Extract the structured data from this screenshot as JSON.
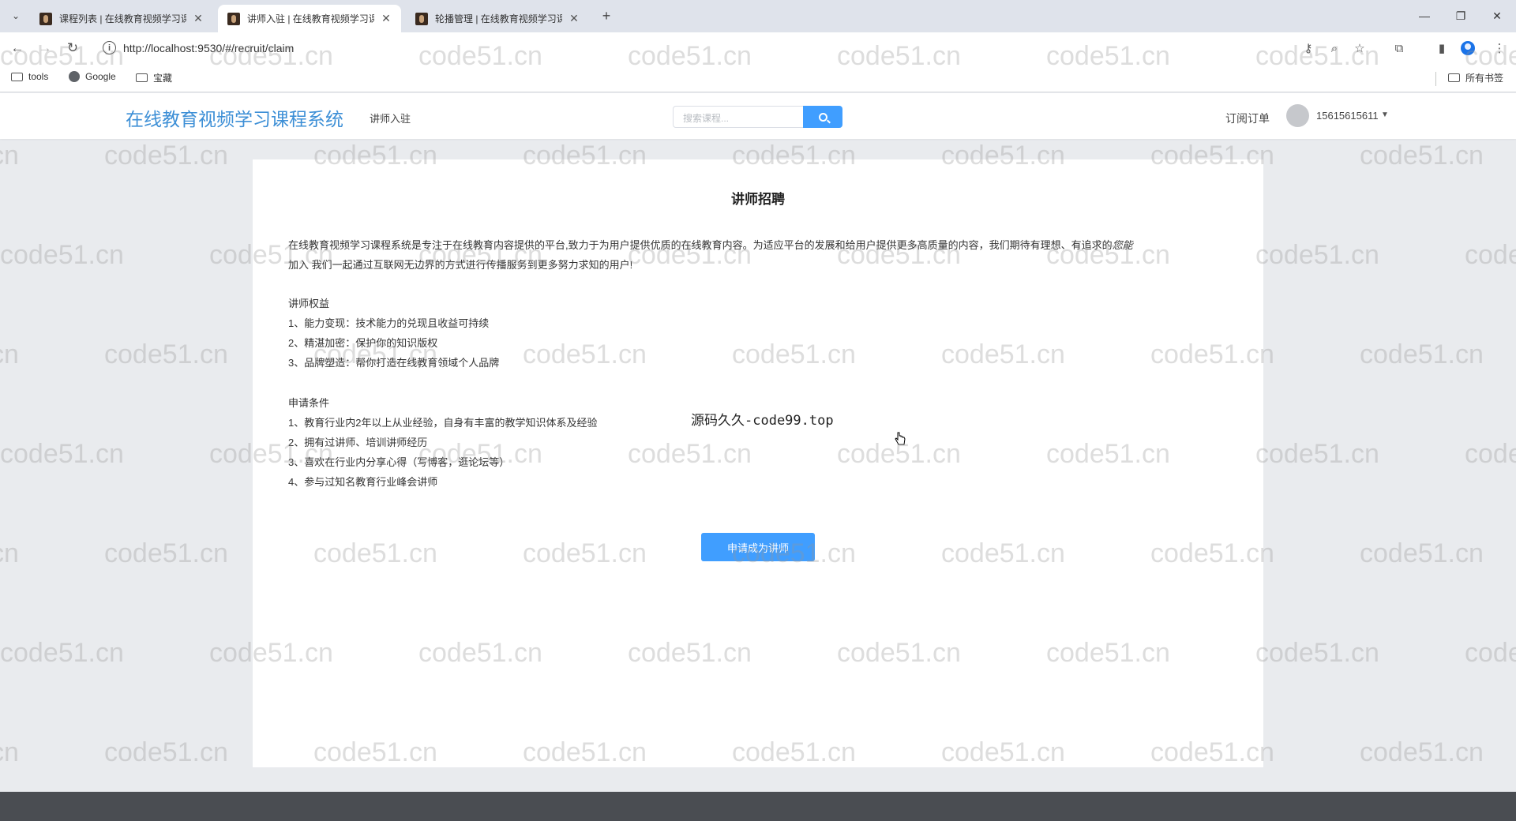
{
  "browser": {
    "tabs": [
      {
        "title": "课程列表 | 在线教育视频学习课",
        "active": false
      },
      {
        "title": "讲师入驻 | 在线教育视频学习课",
        "active": true
      },
      {
        "title": "轮播管理 | 在线教育视频学习课",
        "active": false
      }
    ],
    "url": "http://localhost:9530/#/recruit/claim",
    "bookmarks": [
      {
        "label": "tools",
        "icon": "folder-icon"
      },
      {
        "label": "Google",
        "icon": "globe-icon"
      },
      {
        "label": "宝藏",
        "icon": "folder-icon"
      }
    ],
    "all_bookmarks_label": "所有书签"
  },
  "header": {
    "logo": "在线教育视频学习课程系统",
    "nav_link": "讲师入驻",
    "search_placeholder": "搜索课程...",
    "orders_link": "订阅订单",
    "user_phone": "15615615611"
  },
  "main": {
    "title": "讲师招聘",
    "intro_line1": "在线教育视频学习课程系统是专注于在线教育内容提供的平台,致力于为用户提供优质的在线教育内容。为适应平台的发展和给用户提供更多高质量的内容，我们期待有理想、有追求的",
    "intro_em": "您能",
    "intro_line2": "加入 我们一起通过互联网无边界的方式进行传播服务到更多努力求知的用户!",
    "benefits_heading": "讲师权益",
    "benefits": [
      "1、能力变现：技术能力的兑现且收益可持续",
      "2、精湛加密：保护你的知识版权",
      "3、品牌塑造：帮你打造在线教育领域个人品牌"
    ],
    "conditions_heading": "申请条件",
    "conditions": [
      "1、教育行业内2年以上从业经验，自身有丰富的教学知识体系及经验",
      "2、拥有过讲师、培训讲师经历",
      "3、喜欢在行业内分享心得（写博客，逛论坛等）",
      "4、参与过知名教育行业峰会讲师"
    ],
    "apply_button": "申请成为讲师"
  },
  "overlay_text": "源码久久-code99.top",
  "watermark_text": "code51.cn",
  "colors": {
    "accent": "#409eff",
    "logo": "#3d8fd6",
    "footer": "#4a4d52",
    "page_bg": "#e9ebee"
  }
}
